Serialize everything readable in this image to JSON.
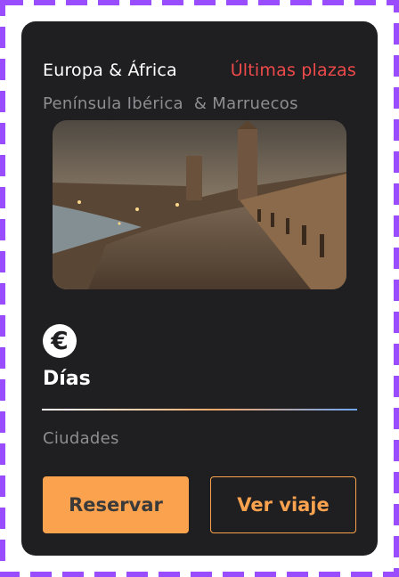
{
  "card": {
    "region": "Europa & África",
    "badge": "Últimas plazas",
    "subtitle": "Península Ibérica  & Marruecos",
    "price_icon": "euro-icon",
    "days_label": "Días",
    "cities_label": "Ciudades",
    "reserve_label": "Reservar",
    "view_trip_label": "Ver viaje"
  },
  "colors": {
    "card_background": "#1f1f22",
    "badge": "#ef4a4a",
    "accent": "#fba24e",
    "muted_text": "#8e8e92",
    "frame_dashes": "#9a4dff"
  }
}
